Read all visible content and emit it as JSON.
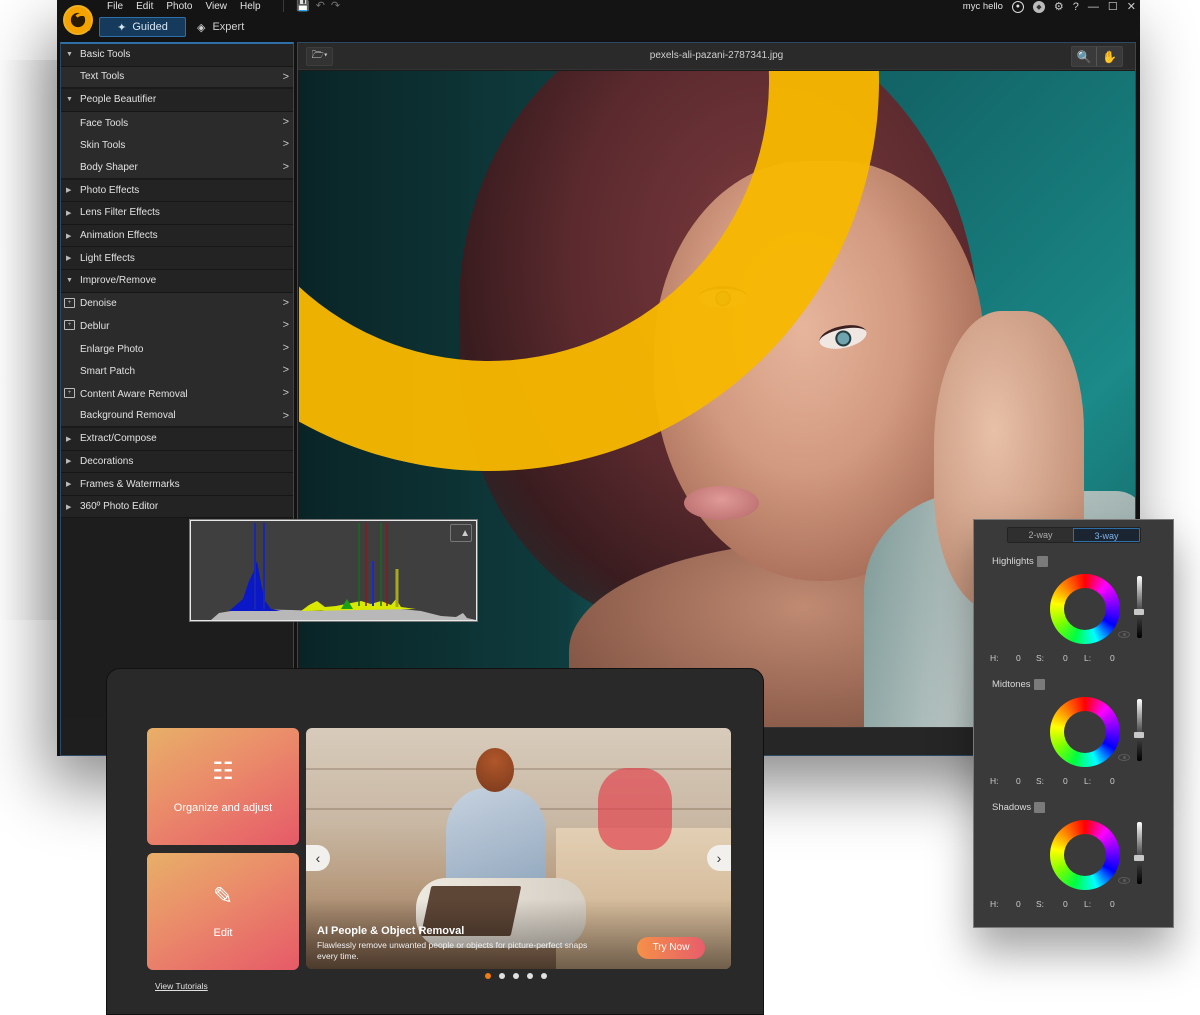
{
  "app": {
    "menu": [
      "File",
      "Edit",
      "Photo",
      "View",
      "Help"
    ],
    "modes": {
      "guided": "Guided",
      "expert": "Expert",
      "active": "Guided"
    },
    "user_name": "myc hello",
    "window_controls": [
      "minimize",
      "maximize",
      "close"
    ],
    "icons": {
      "save": "save-icon",
      "undo": "undo-icon",
      "redo": "redo-icon",
      "account": "account-icon",
      "notification": "bell-icon",
      "settings": "gear-icon",
      "help": "?"
    }
  },
  "sidebar": {
    "items": [
      {
        "type": "category",
        "label": "Basic Tools",
        "expanded": true
      },
      {
        "type": "tool",
        "label": "Text Tools",
        "ai": false
      },
      {
        "type": "category",
        "label": "People Beautifier",
        "expanded": true
      },
      {
        "type": "tool",
        "label": "Face Tools",
        "ai": false
      },
      {
        "type": "tool",
        "label": "Skin Tools",
        "ai": false
      },
      {
        "type": "tool",
        "label": "Body Shaper",
        "ai": false
      },
      {
        "type": "category",
        "label": "Photo Effects",
        "expanded": false
      },
      {
        "type": "category",
        "label": "Lens Filter Effects",
        "expanded": false
      },
      {
        "type": "category",
        "label": "Animation Effects",
        "expanded": false
      },
      {
        "type": "category",
        "label": "Light Effects",
        "expanded": false
      },
      {
        "type": "category",
        "label": "Improve/Remove",
        "expanded": true
      },
      {
        "type": "tool",
        "label": "Denoise",
        "ai": true
      },
      {
        "type": "tool",
        "label": "Deblur",
        "ai": true
      },
      {
        "type": "tool",
        "label": "Enlarge Photo",
        "ai": false
      },
      {
        "type": "tool",
        "label": "Smart Patch",
        "ai": false
      },
      {
        "type": "tool",
        "label": "Content Aware Removal",
        "ai": true
      },
      {
        "type": "tool",
        "label": "Background Removal",
        "ai": false
      },
      {
        "type": "category",
        "label": "Extract/Compose",
        "expanded": false
      },
      {
        "type": "category",
        "label": "Decorations",
        "expanded": false
      },
      {
        "type": "category",
        "label": "Frames & Watermarks",
        "expanded": false
      },
      {
        "type": "category",
        "label": "360º Photo Editor",
        "expanded": false
      }
    ]
  },
  "viewer": {
    "filename": "pexels-ali-pazani-2787341.jpg",
    "tools": [
      "zoom-icon",
      "hand-pan-icon"
    ]
  },
  "histogram": {
    "warning_icon": "clipping-warning-icon"
  },
  "color_wheels": {
    "tabs": [
      "2-way",
      "3-way"
    ],
    "active_tab": "3-way",
    "sections": [
      {
        "label": "Highlights",
        "checked": false,
        "H": "0",
        "S": "0",
        "L": "0",
        "lightness_level": 0.5
      },
      {
        "label": "Midtones",
        "checked": false,
        "H": "0",
        "S": "0",
        "L": "0",
        "lightness_level": 0.5
      },
      {
        "label": "Shadows",
        "checked": false,
        "H": "0",
        "S": "0",
        "L": "0",
        "lightness_level": 0.5
      }
    ],
    "hsl_labels": {
      "h": "H:",
      "s": "S:",
      "l": "L:"
    }
  },
  "welcome": {
    "cards": [
      {
        "label": "Organize and adjust",
        "icon": "sliders-icon"
      },
      {
        "label": "Edit",
        "icon": "image-edit-icon"
      }
    ],
    "banner": {
      "title": "AI People & Object Removal",
      "description": "Flawlessly remove unwanted people or objects for picture-perfect snaps every time.",
      "cta": "Try Now",
      "slides": 5,
      "active_slide": 1
    },
    "tutorials_link": "View Tutorials",
    "accent": "#f07c10"
  }
}
